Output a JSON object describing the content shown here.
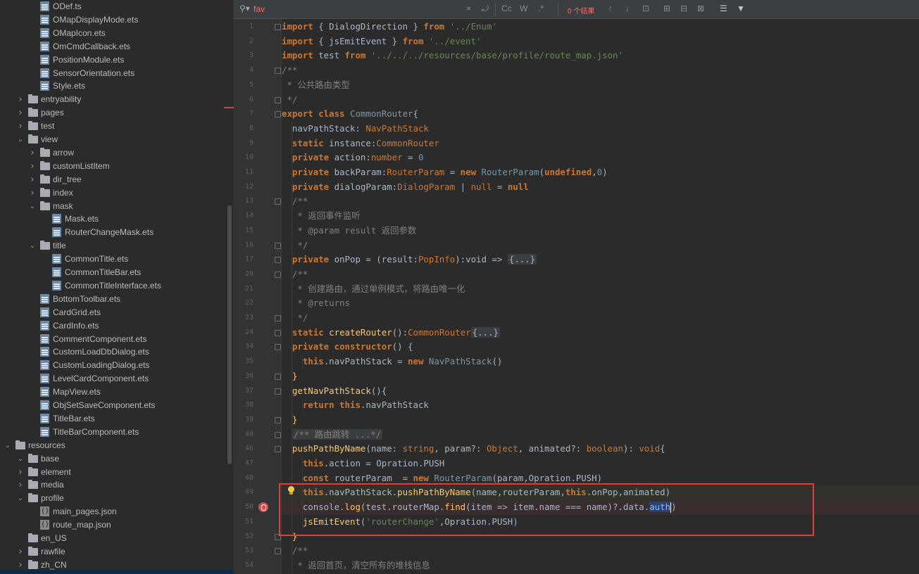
{
  "project_tree": {
    "items": [
      {
        "label": "ODef.ts",
        "kind": "file",
        "depth": 3,
        "expand": ""
      },
      {
        "label": "OMapDisplayMode.ets",
        "kind": "file",
        "depth": 3,
        "expand": ""
      },
      {
        "label": "OMapIcon.ets",
        "kind": "file",
        "depth": 3,
        "expand": ""
      },
      {
        "label": "OmCmdCallback.ets",
        "kind": "file",
        "depth": 3,
        "expand": ""
      },
      {
        "label": "PositionModule.ets",
        "kind": "file",
        "depth": 3,
        "expand": ""
      },
      {
        "label": "SensorOrientation.ets",
        "kind": "file",
        "depth": 3,
        "expand": ""
      },
      {
        "label": "Style.ets",
        "kind": "file",
        "depth": 3,
        "expand": ""
      },
      {
        "label": "entryability",
        "kind": "folder",
        "depth": 2,
        "expand": "collapsed"
      },
      {
        "label": "pages",
        "kind": "folder",
        "depth": 2,
        "expand": "collapsed"
      },
      {
        "label": "test",
        "kind": "folder",
        "depth": 2,
        "expand": "collapsed"
      },
      {
        "label": "view",
        "kind": "folder",
        "depth": 2,
        "expand": "expanded"
      },
      {
        "label": "arrow",
        "kind": "folder",
        "depth": 3,
        "expand": "collapsed"
      },
      {
        "label": "customListItem",
        "kind": "folder",
        "depth": 3,
        "expand": "collapsed"
      },
      {
        "label": "dir_tree",
        "kind": "folder",
        "depth": 3,
        "expand": "collapsed"
      },
      {
        "label": "index",
        "kind": "folder",
        "depth": 3,
        "expand": "collapsed"
      },
      {
        "label": "mask",
        "kind": "folder",
        "depth": 3,
        "expand": "expanded"
      },
      {
        "label": "Mask.ets",
        "kind": "file",
        "depth": 4,
        "expand": ""
      },
      {
        "label": "RouterChangeMask.ets",
        "kind": "file",
        "depth": 4,
        "expand": ""
      },
      {
        "label": "title",
        "kind": "folder",
        "depth": 3,
        "expand": "expanded"
      },
      {
        "label": "CommonTitle.ets",
        "kind": "file",
        "depth": 4,
        "expand": ""
      },
      {
        "label": "CommonTitleBar.ets",
        "kind": "file",
        "depth": 4,
        "expand": ""
      },
      {
        "label": "CommonTitleInterface.ets",
        "kind": "file",
        "depth": 4,
        "expand": ""
      },
      {
        "label": "BottomToolbar.ets",
        "kind": "file",
        "depth": 3,
        "expand": ""
      },
      {
        "label": "CardGrid.ets",
        "kind": "file",
        "depth": 3,
        "expand": ""
      },
      {
        "label": "CardInfo.ets",
        "kind": "file",
        "depth": 3,
        "expand": ""
      },
      {
        "label": "CommentComponent.ets",
        "kind": "file",
        "depth": 3,
        "expand": ""
      },
      {
        "label": "CustomLoadDbDialog.ets",
        "kind": "file",
        "depth": 3,
        "expand": ""
      },
      {
        "label": "CustomLoadingDialog.ets",
        "kind": "file",
        "depth": 3,
        "expand": ""
      },
      {
        "label": "LevelCardComponent.ets",
        "kind": "file",
        "depth": 3,
        "expand": ""
      },
      {
        "label": "MapView.ets",
        "kind": "file",
        "depth": 3,
        "expand": ""
      },
      {
        "label": "ObjSetSaveComponent.ets",
        "kind": "file",
        "depth": 3,
        "expand": ""
      },
      {
        "label": "TitleBar.ets",
        "kind": "file",
        "depth": 3,
        "expand": ""
      },
      {
        "label": "TitleBarComponent.ets",
        "kind": "file",
        "depth": 3,
        "expand": ""
      },
      {
        "label": "resources",
        "kind": "folder",
        "depth": 0,
        "expand": "expanded"
      },
      {
        "label": "base",
        "kind": "folder",
        "depth": 1,
        "expand": "expanded"
      },
      {
        "label": "element",
        "kind": "folder",
        "depth": 2,
        "expand": "collapsed"
      },
      {
        "label": "media",
        "kind": "folder",
        "depth": 2,
        "expand": "collapsed"
      },
      {
        "label": "profile",
        "kind": "folder",
        "depth": 2,
        "expand": "expanded"
      },
      {
        "label": "main_pages.json",
        "kind": "json",
        "depth": 3,
        "expand": ""
      },
      {
        "label": "route_map.json",
        "kind": "json",
        "depth": 3,
        "expand": ""
      },
      {
        "label": "en_US",
        "kind": "folder",
        "depth": 1,
        "expand": ""
      },
      {
        "label": "rawfile",
        "kind": "folder",
        "depth": 1,
        "expand": "collapsed"
      },
      {
        "label": "zh_CN",
        "kind": "folder",
        "depth": 1,
        "expand": "collapsed"
      }
    ]
  },
  "find_bar": {
    "query": "fav",
    "result_count": "0 个结果",
    "icons": [
      "clear-icon",
      "history-icon",
      "match-case-icon",
      "words-icon",
      "regex-icon",
      "prev-occurrence-icon",
      "next-occurrence-icon",
      "open-in-window-icon",
      "add-selection-icon",
      "remove-selection-icon",
      "select-all-icon",
      "filter-icon",
      "funnel-icon"
    ],
    "icon_glyphs": {
      "clear": "×",
      "history": "⤾",
      "match_case": "Cc",
      "words": "W",
      "regex": ".*",
      "prev": "↑",
      "next": "↓",
      "open_window": "⊡",
      "add_sel": "⊞",
      "remove_sel": "⊟",
      "select_all": "⊠",
      "filter": "☰",
      "funnel": "▼"
    }
  },
  "code_lines": [
    {
      "n": "1",
      "fold": true,
      "indent": 0,
      "html": "<span class='kw'>import</span> { DialogDirection } <span class='kw'>from</span> <span class='str'>'../Enum'</span>"
    },
    {
      "n": "2",
      "fold": false,
      "indent": 0,
      "html": "<span class='kw'>import</span> { jsEmitEvent } <span class='kw'>from</span> <span class='str'>'../event'</span>"
    },
    {
      "n": "3",
      "fold": false,
      "indent": 0,
      "html": "<span class='kw'>import</span> test <span class='kw'>from</span> <span class='str'>'../../../resources/base/profile/route_map.json'</span>"
    },
    {
      "n": "4",
      "fold": true,
      "indent": 0,
      "html": "<span class='cmt'>/**</span>"
    },
    {
      "n": "5",
      "fold": false,
      "indent": 0,
      "html": "<span class='cmt'> * 公共路由类型</span>"
    },
    {
      "n": "6",
      "fold": true,
      "indent": 0,
      "html": "<span class='cmt'> */</span>"
    },
    {
      "n": "7",
      "fold": true,
      "indent": 0,
      "html": "<span class='kw'>export class</span> <span class='cls'>CommonRouter</span>{"
    },
    {
      "n": "8",
      "fold": false,
      "indent": 1,
      "html": "  navPathStack: <span class='ty'>NavPathStack</span>"
    },
    {
      "n": "9",
      "fold": false,
      "indent": 1,
      "html": "  <span class='kw'>static</span> instance:<span class='ty'>CommonRouter</span>"
    },
    {
      "n": "10",
      "fold": false,
      "indent": 1,
      "html": "  <span class='kw'>private</span> action:<span class='ty'>number</span> = <span class='num'>0</span>"
    },
    {
      "n": "11",
      "fold": false,
      "indent": 1,
      "html": "  <span class='kw'>private</span> backParam:<span class='ty'>RouterParam</span> = <span class='kw'>new</span> <span class='cls'>RouterParam</span>(<span class='kw'>undefined</span>,<span class='num'>0</span>)"
    },
    {
      "n": "12",
      "fold": false,
      "indent": 1,
      "html": "  <span class='kw'>private</span> dialogParam:<span class='ty'>DialogParam</span> | <span class='ty'>null</span> = <span class='kw'>null</span>"
    },
    {
      "n": "13",
      "fold": true,
      "indent": 1,
      "html": "  <span class='cmt'>/**</span>"
    },
    {
      "n": "14",
      "fold": false,
      "indent": 1,
      "html": "<span class='cmt'>   * 返回事件监听</span>"
    },
    {
      "n": "15",
      "fold": false,
      "indent": 1,
      "html": "<span class='cmt'>   * @param result 返回参数</span>"
    },
    {
      "n": "16",
      "fold": true,
      "indent": 1,
      "html": "<span class='cmt'>   */</span>"
    },
    {
      "n": "17",
      "fold": true,
      "indent": 1,
      "html": "  <span class='kw'>private</span> onPop = (result:<span class='ty'>PopInfo</span>):void => <span class='fold-ph'>{...}</span>"
    },
    {
      "n": "20",
      "fold": true,
      "indent": 1,
      "html": "  <span class='cmt'>/**</span>"
    },
    {
      "n": "21",
      "fold": false,
      "indent": 1,
      "html": "<span class='cmt'>   * 创建路由，通过单例模式，将路由唯一化</span>"
    },
    {
      "n": "22",
      "fold": false,
      "indent": 1,
      "html": "<span class='cmt'>   * @returns</span>"
    },
    {
      "n": "23",
      "fold": true,
      "indent": 1,
      "html": "<span class='cmt'>   */</span>"
    },
    {
      "n": "24",
      "fold": true,
      "indent": 1,
      "html": "  <span class='kw'>static</span> <span class='fn'>createRouter</span>():<span class='ty'>CommonRouter</span><span class='fold-ph'>{...}</span>"
    },
    {
      "n": "34",
      "fold": true,
      "indent": 1,
      "html": "  <span class='kw'>private</span> <span class='kw'>constructor</span>() {"
    },
    {
      "n": "35",
      "fold": false,
      "indent": 2,
      "html": "    <span class='kw'>this</span>.navPathStack = <span class='kw'>new</span> <span class='cls'>NavPathStack</span>()"
    },
    {
      "n": "36",
      "fold": true,
      "indent": 1,
      "html": "  <span class='fn'>}</span>"
    },
    {
      "n": "37",
      "fold": true,
      "indent": 1,
      "html": "  <span class='fn'>getNavPathStack</span>(){"
    },
    {
      "n": "38",
      "fold": false,
      "indent": 2,
      "html": "    <span class='kw'>return this</span>.navPathStack"
    },
    {
      "n": "39",
      "fold": true,
      "indent": 1,
      "html": "  <span class='fn'>}</span>"
    },
    {
      "n": "40",
      "fold": true,
      "indent": 1,
      "html": "  <span class='fold-ph'><span class='cmt'>/** 路由跳转 ...*/</span></span>"
    },
    {
      "n": "46",
      "fold": true,
      "indent": 1,
      "html": "  <span class='fn'>pushPathByName</span>(name: <span class='ty'>string</span>, param?: <span class='ty'>Object</span>, animated?: <span class='ty'>boolean</span>): <span class='ty'>void</span>{"
    },
    {
      "n": "47",
      "fold": false,
      "indent": 2,
      "html": "    <span class='kw'>this</span>.action = Opration.PUSH"
    },
    {
      "n": "48",
      "fold": false,
      "indent": 2,
      "html": "    <span class='kw'>const</span> routerParam  = <span class='kw'>new</span> <span class='cls'>RouterParam</span>(param,Opration.PUSH)"
    },
    {
      "n": "49",
      "fold": false,
      "indent": 2,
      "hl": true,
      "html": "    <span class='kw'>this</span>.navPathStack.<span class='fn'>pushPathByName</span>(name,routerParam,<span class='kw'>this</span>.onPop,animated)"
    },
    {
      "n": "50",
      "fold": false,
      "indent": 2,
      "err": true,
      "html": "    console.<span class='fn'>log</span>(test.routerMap.<span class='fn'>find</span>(item => item.name === name)?.data.<span class='sel'>auth</span><span class='caret'></span>)"
    },
    {
      "n": "51",
      "fold": false,
      "indent": 2,
      "html": "    <span class='fn'>jsEmitEvent</span>(<span class='str'>'routerChange'</span>,Opration.PUSH)"
    },
    {
      "n": "52",
      "fold": true,
      "indent": 1,
      "html": "  <span class='fn'>}</span>"
    },
    {
      "n": "53",
      "fold": true,
      "indent": 1,
      "html": "  <span class='cmt'>/**</span>"
    },
    {
      "n": "54",
      "fold": false,
      "indent": 1,
      "html": "<span class='cmt'>   * 返回首页，清空所有的堆栈信息</span>"
    }
  ]
}
